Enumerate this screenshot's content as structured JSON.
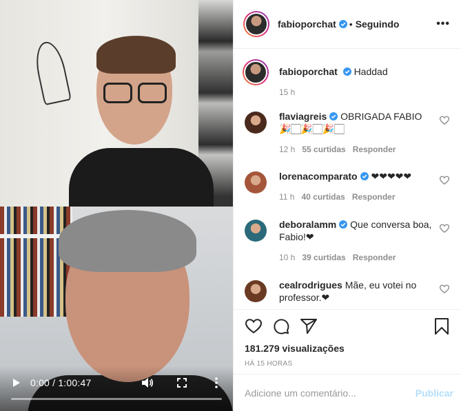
{
  "video": {
    "time": "0:00 / 1:00:47",
    "progress": 0.0,
    "icons": [
      "play-icon",
      "volume-icon",
      "fullscreen-icon",
      "more-vert-icon"
    ]
  },
  "header": {
    "username": "fabioporchat",
    "separator": "•",
    "follow_label": "Seguindo",
    "more_label": "•••"
  },
  "caption": {
    "username": "fabioporchat",
    "text": "Haddad",
    "time": "15 h"
  },
  "comments": [
    {
      "username": "flaviagreis",
      "verified": true,
      "text": "OBRIGADA FABIO 🎉🏻🎉🏻🎉🏻",
      "time": "12 h",
      "likes": "55 curtidas",
      "reply": "Responder",
      "avatar_color": "#4a2a1c"
    },
    {
      "username": "lorenacomparato",
      "verified": true,
      "text": "❤❤❤❤❤",
      "time": "11 h",
      "likes": "40 curtidas",
      "reply": "Responder",
      "avatar_color": "#a5563a"
    },
    {
      "username": "deboralamm",
      "verified": true,
      "text": "Que conversa boa, Fabio!❤",
      "time": "10 h",
      "likes": "39 curtidas",
      "reply": "Responder",
      "avatar_color": "#2a6a7a"
    },
    {
      "username": "cealrodrigues",
      "verified": false,
      "text": "Mãe, eu votei no professor.❤",
      "time": "",
      "likes": "",
      "reply": "",
      "avatar_color": "#6a3a22"
    }
  ],
  "stats": {
    "views": "181.279 visualizações",
    "ago": "HÁ 15 HORAS"
  },
  "add_comment": {
    "placeholder": "Adicione um comentário...",
    "publish": "Publicar"
  },
  "colors": {
    "verified": "#3897f0",
    "muted": "#8e8e8e",
    "publish_disabled": "#b2dffc"
  }
}
